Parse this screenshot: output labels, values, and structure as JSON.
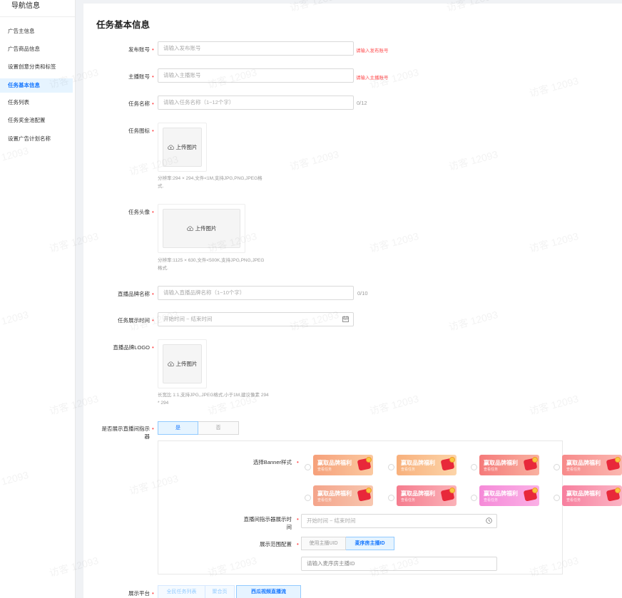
{
  "sidebar": {
    "title": "导航信息",
    "items": [
      {
        "label": "广告主信息"
      },
      {
        "label": "广告商品信息"
      },
      {
        "label": "设置创意分类和标签"
      },
      {
        "label": "任务基本信息"
      },
      {
        "label": "任务列表"
      },
      {
        "label": "任务奖金池配置"
      },
      {
        "label": "设置广告计划名称"
      }
    ]
  },
  "page": {
    "title": "任务基本信息"
  },
  "form": {
    "publisher_account": {
      "label": "发布账号",
      "placeholder": "请输入发布账号",
      "error": "请输入发布账号"
    },
    "anchor_account": {
      "label": "主播账号",
      "placeholder": "请输入主播账号",
      "error": "请输入主播账号"
    },
    "task_name": {
      "label": "任务名称",
      "placeholder": "请输入任务名称（1~12个字）",
      "counter": "0/12"
    },
    "task_icon": {
      "label": "任务图标",
      "upload_label": "上传图片",
      "hint_line1": "分辨率:294 × 294,文件<1M,支持JPG,PNG,JPEG格",
      "hint_line2": "式."
    },
    "task_avatar": {
      "label": "任务头像",
      "upload_label": "上传图片",
      "hint_line1": "分辨率:1125 × 630,文件<500K,支持JPG,PNG,JPEG",
      "hint_line2": "格式."
    },
    "brand_name": {
      "label": "直播品牌名称",
      "placeholder": "请输入直播品牌名称（1~10个字）",
      "counter": "0/10"
    },
    "display_time": {
      "label": "任务展示时间",
      "placeholder": "开始时间 ~ 结束时间"
    },
    "brand_logo": {
      "label": "直播品牌LOGO",
      "upload_label": "上传图片",
      "hint_line1": "长宽比 1:1,支持JPG,,JPEG格式,小于1M,建议像素 294",
      "hint_line2": "* 294"
    },
    "show_indicator": {
      "label_line1": "是否展示直播间指示",
      "label_line2": "器",
      "options": [
        "是",
        "否"
      ]
    },
    "banner_style": {
      "label": "选择Banner样式",
      "title": "赢取品牌福利",
      "subtitle": "查看任务"
    },
    "indicator_time": {
      "label_line1": "直播间指示器展示时",
      "label_line2": "间",
      "placeholder": "开始时间  ~  结束时间"
    },
    "scope": {
      "label": "展示范围配置",
      "options": [
        "使用主播UID",
        "麦序房主播ID"
      ],
      "placeholder": "请输入麦序房主播ID"
    },
    "platform": {
      "label": "展示平台",
      "options": [
        "全民任务列表",
        "聚合页",
        "西瓜视频直播流"
      ]
    }
  },
  "watermark": "访客 12093",
  "colors": {
    "accent": "#1677ff",
    "error": "#ff4d4f",
    "required": "#ff4d4f"
  },
  "banners": [
    {
      "gradient": "linear-gradient(90deg,#f6a07a,#fbc9a0)"
    },
    {
      "gradient": "linear-gradient(90deg,#f8b07c,#fcd4a8)"
    },
    {
      "gradient": "linear-gradient(90deg,#f57a7a,#f9b1a0)"
    },
    {
      "gradient": "linear-gradient(90deg,#f78a8a,#fbb7b0)"
    },
    {
      "gradient": "linear-gradient(90deg,#f4a48a,#f8c7b0)"
    },
    {
      "gradient": "linear-gradient(90deg,#f57c8e,#fbb2b8)"
    },
    {
      "gradient": "linear-gradient(90deg,#f58ad8,#fbb0e6)"
    },
    {
      "gradient": "linear-gradient(90deg,#f77f9e,#fbb4c4)"
    }
  ]
}
